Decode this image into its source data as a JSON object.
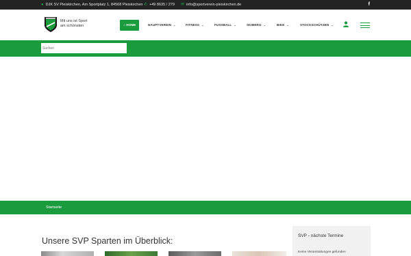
{
  "topbar": {
    "address": "DJK SV Pleiskirchen, Am Sportplatz 1, 84568 Pleiskirchen",
    "phone": "+49 8635 / 279",
    "email": "info@sportverein-pleiskirchen.de",
    "facebook_glyph": "f"
  },
  "logo": {
    "line1": "Mit uns ist Sport",
    "line2": "am schönsten"
  },
  "nav": {
    "home": "HOME",
    "items": [
      {
        "label": "HAUPTVEREIN",
        "has_dropdown": true
      },
      {
        "label": "FITNESS",
        "has_dropdown": true
      },
      {
        "label": "FUSSBALL",
        "has_dropdown": true
      },
      {
        "label": "SKIBERG",
        "has_dropdown": true
      },
      {
        "label": "BIKE",
        "has_dropdown": true
      },
      {
        "label": "STOCKSCHÜTZEN",
        "has_dropdown": true
      }
    ]
  },
  "search": {
    "placeholder": "Suchen"
  },
  "breadcrumb": {
    "label": "Startseite"
  },
  "main": {
    "section_title": "Unsere SVP Sparten im Überblick:"
  },
  "sidebar": {
    "title": "SVP - nächste Termine",
    "empty_text": "Keine Veranstaltungen gefunden"
  },
  "colors": {
    "brand_green": "#1a9b3e",
    "topbar_bg": "#232323",
    "sidebar_bg": "#f1f1f1"
  }
}
